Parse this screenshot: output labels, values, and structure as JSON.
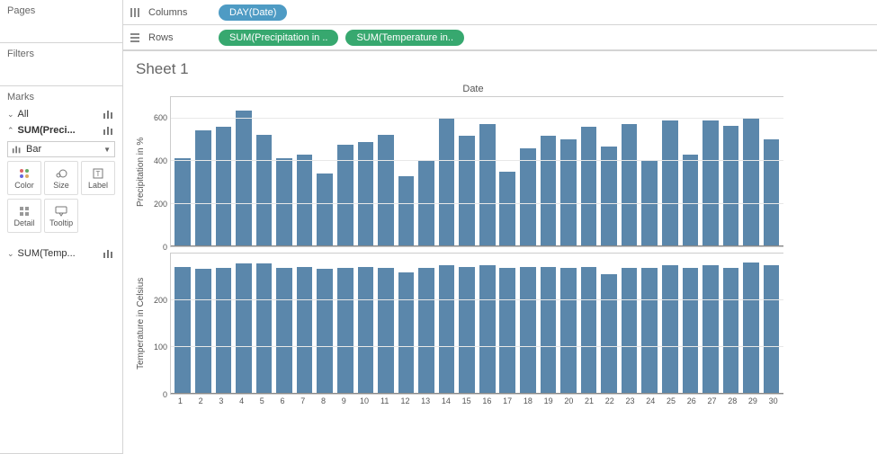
{
  "panels": {
    "pages_title": "Pages",
    "filters_title": "Filters",
    "marks_title": "Marks"
  },
  "shelves": {
    "columns_label": "Columns",
    "rows_label": "Rows",
    "columns_pill": "DAY(Date)",
    "rows_pill_1": "SUM(Precipitation in ..",
    "rows_pill_2": "SUM(Temperature in.."
  },
  "marks": {
    "all_label": "All",
    "card1_label": "SUM(Preci...",
    "card2_label": "SUM(Temp...",
    "type_label": "Bar",
    "buttons": {
      "color": "Color",
      "size": "Size",
      "label": "Label",
      "detail": "Detail",
      "tooltip": "Tooltip"
    }
  },
  "viz": {
    "sheet_title": "Sheet 1",
    "date_label": "Date",
    "y1_label": "Precipitation in %",
    "y2_label": "Temperature in Celsius"
  },
  "chart_data": [
    {
      "type": "bar",
      "title": "Date",
      "ylabel": "Precipitation in %",
      "ylim": [
        0,
        700
      ],
      "yticks": [
        0,
        200,
        400,
        600
      ],
      "categories": [
        1,
        2,
        3,
        4,
        5,
        6,
        7,
        8,
        9,
        10,
        11,
        12,
        13,
        14,
        15,
        16,
        17,
        18,
        19,
        20,
        21,
        22,
        23,
        24,
        25,
        26,
        27,
        28,
        29,
        30
      ],
      "values": [
        415,
        545,
        560,
        635,
        525,
        415,
        430,
        340,
        475,
        490,
        525,
        330,
        405,
        605,
        520,
        575,
        350,
        460,
        520,
        500,
        560,
        470,
        575,
        400,
        590,
        430,
        590,
        565,
        600,
        500
      ]
    },
    {
      "type": "bar",
      "ylabel": "Temperature in Celsius",
      "ylim": [
        0,
        300
      ],
      "yticks": [
        0,
        100,
        200
      ],
      "categories": [
        1,
        2,
        3,
        4,
        5,
        6,
        7,
        8,
        9,
        10,
        11,
        12,
        13,
        14,
        15,
        16,
        17,
        18,
        19,
        20,
        21,
        22,
        23,
        24,
        25,
        26,
        27,
        28,
        29,
        30
      ],
      "values": [
        272,
        268,
        270,
        278,
        278,
        270,
        272,
        268,
        270,
        272,
        270,
        260,
        270,
        275,
        272,
        275,
        270,
        272,
        272,
        270,
        272,
        255,
        270,
        270,
        275,
        270,
        275,
        270,
        280,
        275
      ]
    }
  ]
}
